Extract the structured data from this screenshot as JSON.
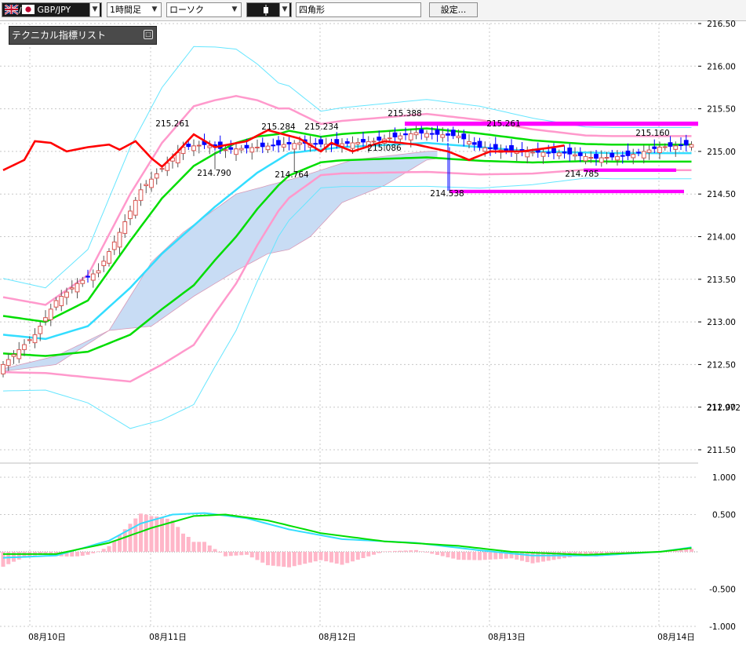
{
  "toolbar": {
    "symbol": "GBP/JPY",
    "timeframe": "1時間足",
    "chart_type": "ローソク",
    "drawing_tool": "四角形",
    "settings_button": "設定..."
  },
  "indicator_panel": {
    "title": "テクニカル指標リスト"
  },
  "colors": {
    "bullish_candle": "#d9534f",
    "bearish_candle": "#0000ff",
    "kijun": "#ff0000",
    "bollinger_inner": "#00dd00",
    "bollinger_mid": "#33ddff",
    "bollinger_2sigma": "#ff99cc",
    "bollinger_3sigma": "#66e6ff",
    "kumo": "#c8dcf4",
    "rectangle": "#ff00ff",
    "macd": "#33ddff",
    "signal": "#00dd00",
    "histogram": "#ffb6c8"
  },
  "chart_data": [
    {
      "type": "candlestick",
      "symbol": "GBP/JPY",
      "yaxis": [
        "216.50",
        "216.00",
        "215.50",
        "215.00",
        "214.50",
        "214.00",
        "213.50",
        "213.00",
        "212.50",
        "212.00",
        "211.50"
      ],
      "ylim": [
        211.5,
        216.5
      ],
      "current_price_label": "211.972",
      "high_low_labels": [
        "215.261",
        "214.790",
        "215.284",
        "214.764",
        "215.234",
        "215.388",
        "215.086",
        "214.538",
        "215.261",
        "214.785",
        "215.160"
      ],
      "rectangles": [
        {
          "top": 215.35,
          "bottom": 215.3,
          "from": "08月12日",
          "to": "08月14日"
        },
        {
          "top": 214.8,
          "bottom": 214.76,
          "from": "08月13日",
          "to": "08月14日"
        },
        {
          "top": 214.55,
          "bottom": 214.51,
          "from": "08月12日",
          "to": "08月14日"
        }
      ]
    },
    {
      "type": "line",
      "name": "MACD",
      "yaxis": [
        "1.000",
        "0.500",
        "-0.500",
        "-1.000"
      ],
      "ylim": [
        -1.0,
        1.0
      ]
    }
  ],
  "xaxis": [
    "08月10日",
    "08月11日",
    "08月12日",
    "08月13日",
    "08月14日"
  ]
}
